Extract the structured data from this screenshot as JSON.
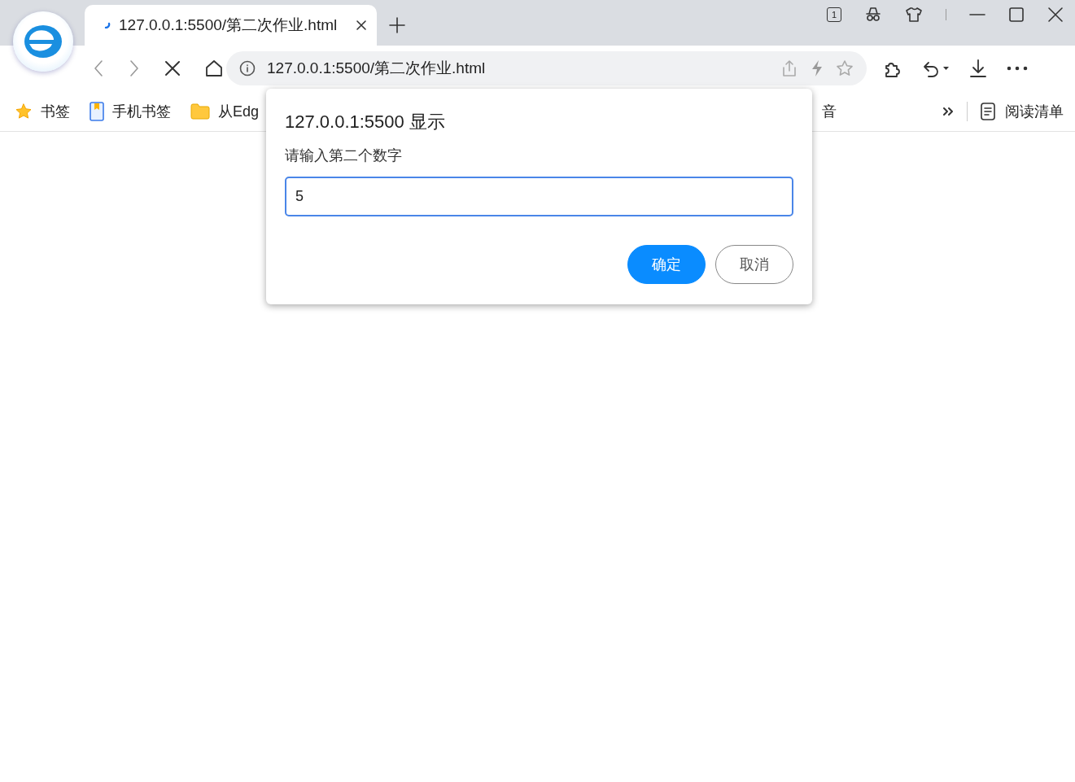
{
  "window": {
    "tab_count": "1"
  },
  "tabs": [
    {
      "title": "127.0.0.1:5500/第二次作业.html",
      "selected": true,
      "loading": true
    }
  ],
  "address_bar": {
    "url": "127.0.0.1:5500/第二次作业.html"
  },
  "bookmarks": [
    {
      "label": "书签",
      "kind": "star"
    },
    {
      "label": "手机书签",
      "kind": "phone"
    },
    {
      "label": "从Edg",
      "kind": "folder"
    },
    {
      "label": "音",
      "kind": "none"
    }
  ],
  "reading_list": {
    "label": "阅读清单"
  },
  "dialog": {
    "title": "127.0.0.1:5500 显示",
    "message": "请输入第二个数字",
    "value": "5",
    "buttons": [
      {
        "label": "确定",
        "kind": "primary"
      },
      {
        "label": "取消",
        "kind": "secondary"
      }
    ]
  }
}
